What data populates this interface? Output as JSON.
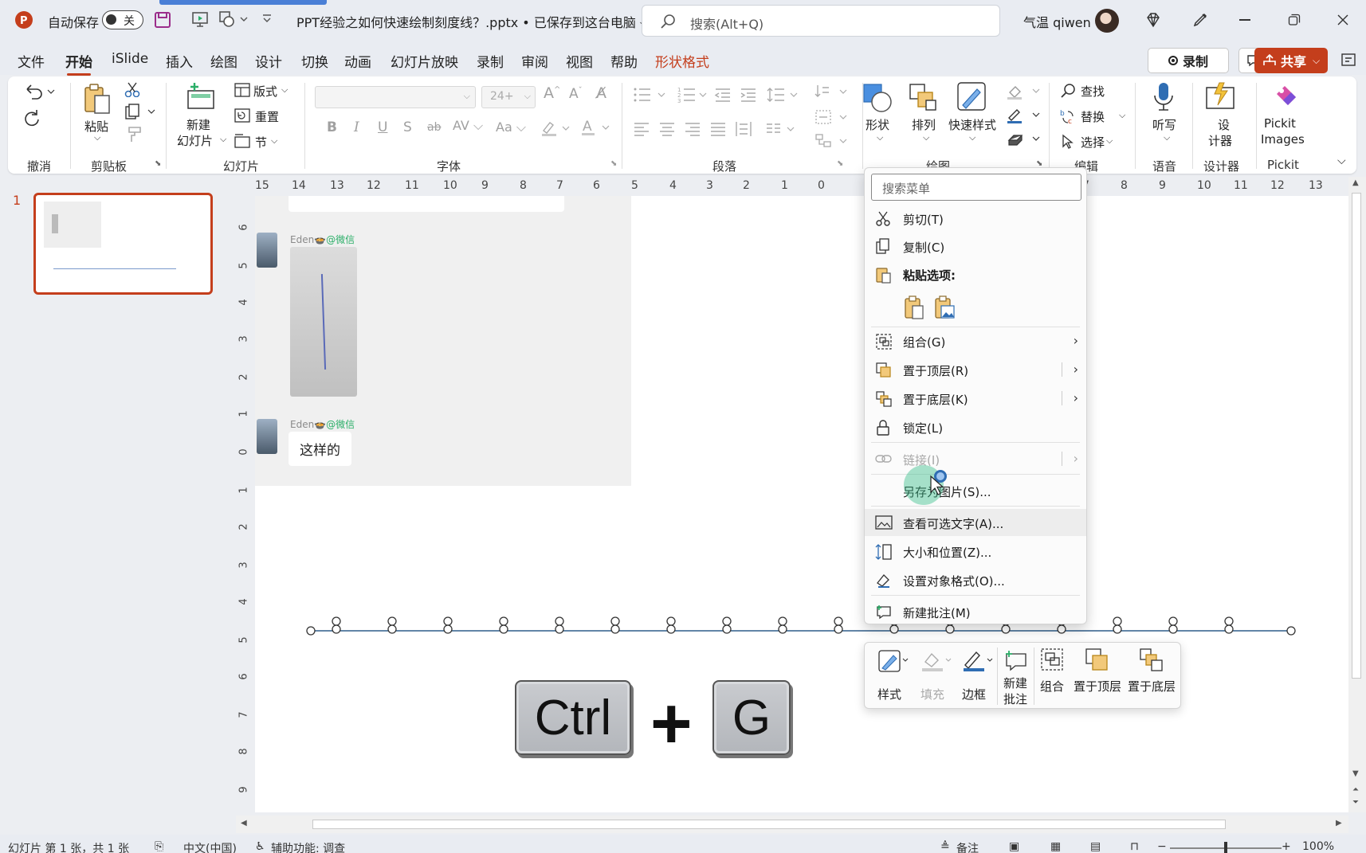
{
  "app": {
    "autosave_label": "自动保存",
    "autosave_state": "关",
    "doc_title": "PPT经验之如何快速绘制刻度线？.pptx • 已保存到这台电脑 ⌵",
    "search_placeholder": "搜索(Alt+Q)",
    "user_name": "气温 qiwen"
  },
  "tabs": [
    "文件",
    "开始",
    "iSlide",
    "插入",
    "绘图",
    "设计",
    "切换",
    "动画",
    "幻灯片放映",
    "录制",
    "审阅",
    "视图",
    "帮助",
    "形状格式"
  ],
  "active_tab": "开始",
  "tab_accent": "#c43e1c",
  "header_buttons": {
    "record": "录制",
    "share": "共享"
  },
  "ribbon": {
    "groups": {
      "undo": "撤消",
      "clipboard": "剪贴板",
      "slides": "幻灯片",
      "font": "字体",
      "paragraph": "段落",
      "drawing": "绘图",
      "editing": "编辑",
      "voice": "语音",
      "designer": "设计器",
      "pickit": "Pickit"
    },
    "paste": "粘贴",
    "new_slide_1": "新建",
    "new_slide_2": "幻灯片",
    "layout": "版式",
    "reset": "重置",
    "section": "节",
    "font_size": "24+",
    "shape": "形状",
    "arrange": "排列",
    "quick_styles": "快速样式",
    "find": "查找",
    "replace": "替换",
    "select": "选择",
    "dictate": "听写",
    "designer_1": "设",
    "designer_2": "计器",
    "pickit_1": "Pickit",
    "pickit_2": "Images"
  },
  "ruler": {
    "h_ticks": [
      "15",
      "14",
      "13",
      "12",
      "11",
      "10",
      "9",
      "8",
      "7",
      "6",
      "5",
      "4",
      "3",
      "2",
      "1",
      "0",
      "7",
      "8",
      "9",
      "10",
      "11",
      "12",
      "13"
    ],
    "v_ticks": [
      "6",
      "5",
      "4",
      "3",
      "2",
      "1",
      "0",
      "1",
      "2",
      "3",
      "4",
      "5",
      "6",
      "7",
      "8",
      "9"
    ]
  },
  "thumbnail": {
    "number": "1"
  },
  "slide": {
    "sender_name": "Eden",
    "sender_source": "@微信",
    "bubble_text": "这样的",
    "key_ctrl": "Ctrl",
    "key_plus": "+",
    "key_g": "G"
  },
  "context_menu": {
    "search_placeholder": "搜索菜单",
    "items": {
      "cut": "剪切(T)",
      "copy": "复制(C)",
      "paste_options": "粘贴选项:",
      "group": "组合(G)",
      "bring_front": "置于顶层(R)",
      "send_back": "置于底层(K)",
      "lock": "锁定(L)",
      "link": "链接(I)",
      "save_picture": "另存为图片(S)...",
      "alt_text": "查看可选文字(A)...",
      "size_position": "大小和位置(Z)...",
      "format_object": "设置对象格式(O)...",
      "new_comment": "新建批注(M)"
    }
  },
  "mini_toolbar": {
    "style": "样式",
    "fill": "填充",
    "outline": "边框",
    "new_comment_1": "新建",
    "new_comment_2": "批注",
    "group": "组合",
    "bring_front": "置于顶层",
    "send_back": "置于底层"
  },
  "status": {
    "slide_info": "幻灯片 第 1 张，共 1 张",
    "language": "中文(中国)",
    "accessibility": "辅助功能: 调查",
    "notes": "备注",
    "zoom": "100%"
  }
}
